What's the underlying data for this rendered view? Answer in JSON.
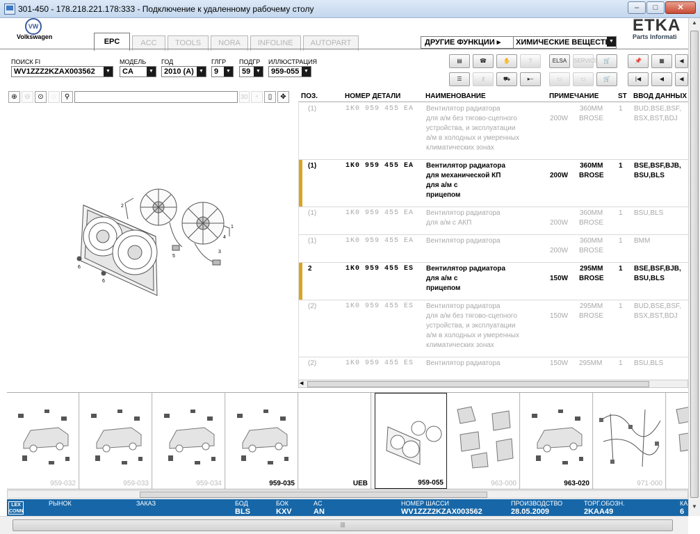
{
  "window": {
    "title": "301-450 - 178.218.221.178:333 - Подключение к удаленному рабочему столу",
    "btn_min": "‒",
    "btn_max": "□",
    "btn_close": "✕"
  },
  "brand": {
    "vw": "Volkswagen",
    "vw_mark": "VW",
    "etka": "ETKA",
    "etka_sub": "Parts Informati"
  },
  "tabs": [
    "EPC",
    "ACC",
    "TOOLS",
    "NORA",
    "INFOLINE",
    "AUTOPART"
  ],
  "other_functions": {
    "label": "ДРУГИЕ ФУНКЦИИ ▸",
    "value": "ХИМИЧЕСКИЕ ВЕЩЕСТВА"
  },
  "filters": [
    {
      "label": "ПОИСК FI",
      "value": "WV1ZZZ2KZAX003562"
    },
    {
      "label": "МОДЕЛЬ",
      "value": "CA"
    },
    {
      "label": "ГОД",
      "value": "2010 (A)"
    },
    {
      "label": "ГЛГР",
      "value": "9"
    },
    {
      "label": "ПОДГР",
      "value": "59"
    },
    {
      "label": "ИЛЛЮСТРАЦИЯ",
      "value": "959-055"
    }
  ],
  "toolbar_labels": {
    "elsa": "ELSA",
    "service": "SERVICE"
  },
  "columns": [
    "ПОЗ.",
    "НОМЕР ДЕТАЛИ",
    "НАИМЕНОВАНИЕ",
    "ПРИМЕЧАНИЕ",
    "ST",
    "ВВОД ДАННЫХ"
  ],
  "rows": [
    {
      "pos": "(1)",
      "part": "1K0 959 455 EA",
      "name": "Вентилятор радиатора\nдля а/м без тягово-сцепного\nустройства, и эксплуатации\nа/м в холодных и умеренных\nклиматических зонах",
      "w": "200W",
      "mm": "360MM\nBROSE",
      "st": "1",
      "data": "BUD,BSE,BSF,\nBSX,BST,BDJ",
      "active": false
    },
    {
      "pos": "(1)",
      "part": "1K0 959 455 EA",
      "name": "Вентилятор радиатора\nдля механической КП\nдля а/м с\nприцепом",
      "w": "200W",
      "mm": "360MM\nBROSE",
      "st": "1",
      "data": "BSE,BSF,BJB,\nBSU,BLS",
      "active": true
    },
    {
      "pos": "(1)",
      "part": "1K0 959 455 EA",
      "name": "Вентилятор радиатора\nдля а/м с АКП",
      "w": "200W",
      "mm": "360MM\nBROSE",
      "st": "1",
      "data": "BSU,BLS",
      "active": false
    },
    {
      "pos": "(1)",
      "part": "1K0 959 455 EA",
      "name": "Вентилятор радиатора",
      "w": "200W",
      "mm": "360MM\nBROSE",
      "st": "1",
      "data": "BMM",
      "active": false
    },
    {
      "pos": "2",
      "part": "1K0 959 455 ES",
      "name": "Вентилятор радиатора\nдля а/м с\nприцепом",
      "w": "150W",
      "mm": "295MM\nBROSE",
      "st": "1",
      "data": "BSE,BSF,BJB,\nBSU,BLS",
      "active": true
    },
    {
      "pos": "(2)",
      "part": "1K0 959 455 ES",
      "name": "Вентилятор радиатора\nдля а/м без тягово-сцепного\nустройства, и эксплуатации\nа/м в холодных и умеренных\nклиматических зонах",
      "w": "150W",
      "mm": "295MM\nBROSE",
      "st": "1",
      "data": "BUD,BSE,BSF,\nBSX,BST,BDJ",
      "active": false
    },
    {
      "pos": "(2)",
      "part": "1K0 959 455 ES",
      "name": "Вентилятор радиатора",
      "w": "150W",
      "mm": "295MM",
      "st": "1",
      "data": "BSU,BLS",
      "active": false
    }
  ],
  "callouts": [
    "1",
    "2",
    "3",
    "4",
    "5",
    "6",
    "6"
  ],
  "thumbnails": [
    {
      "code": "959-032",
      "bold": false,
      "kind": "car"
    },
    {
      "code": "959-033",
      "bold": false,
      "kind": "car"
    },
    {
      "code": "959-034",
      "bold": false,
      "kind": "car"
    },
    {
      "code": "959-035",
      "bold": true,
      "kind": "car"
    },
    {
      "code": "UEB",
      "bold": true,
      "kind": "blank"
    },
    {
      "code": "959-055",
      "bold": true,
      "kind": "fan"
    },
    {
      "code": "963-000",
      "bold": false,
      "kind": "parts"
    },
    {
      "code": "963-020",
      "bold": true,
      "kind": "car"
    },
    {
      "code": "971-000",
      "bold": false,
      "kind": "wires"
    },
    {
      "code": "",
      "bold": false,
      "kind": "parts"
    }
  ],
  "status": {
    "lex": "LEX\nCONN",
    "market_label": "РЫНОК",
    "order_label": "ЗАКАЗ",
    "bod_label": "БОД",
    "bod": "BLS",
    "bok_label": "БОК",
    "bok": "KXV",
    "ac_label": "AC",
    "ac": "AN",
    "chassis_label": "НОМЕР ШАССИ",
    "chassis": "WV1ZZZ2KZAX003562",
    "prod_label": "ПРОИЗВОДСТВО",
    "prod": "28.05.2009",
    "trade_label": "ТОРГ.ОБОЗН.",
    "trade": "2KAA49",
    "ka_label": "КА",
    "ka": "6"
  }
}
